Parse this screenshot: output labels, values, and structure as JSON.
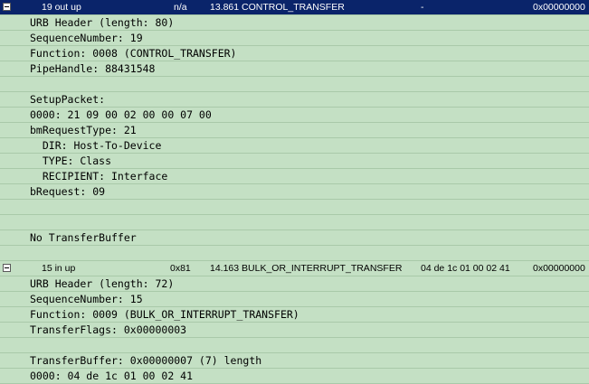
{
  "entries": [
    {
      "header": {
        "seq": "19 out up",
        "endpoint": "n/a",
        "time_function": "13.861 CONTROL_TRANSFER",
        "data": "-",
        "status": "0x00000000"
      },
      "lines": [
        "URB Header (length: 80)",
        "SequenceNumber: 19",
        "Function: 0008 (CONTROL_TRANSFER)",
        "PipeHandle: 88431548",
        "",
        "SetupPacket:",
        "0000: 21 09 00 02 00 00 07 00",
        "bmRequestType: 21",
        "  DIR: Host-To-Device",
        "  TYPE: Class",
        "  RECIPIENT: Interface",
        "bRequest: 09",
        "",
        "",
        "No TransferBuffer",
        ""
      ]
    },
    {
      "header": {
        "seq": "15 in up",
        "endpoint": "0x81",
        "time_function": "14.163 BULK_OR_INTERRUPT_TRANSFER",
        "data": "04 de 1c 01 00 02 41",
        "status": "0x00000000"
      },
      "lines": [
        "URB Header (length: 72)",
        "SequenceNumber: 15",
        "Function: 0009 (BULK_OR_INTERRUPT_TRANSFER)",
        "TransferFlags: 0x00000003",
        "",
        "TransferBuffer: 0x00000007 (7) length",
        "0000: 04 de 1c 01 00 02 41"
      ]
    }
  ]
}
